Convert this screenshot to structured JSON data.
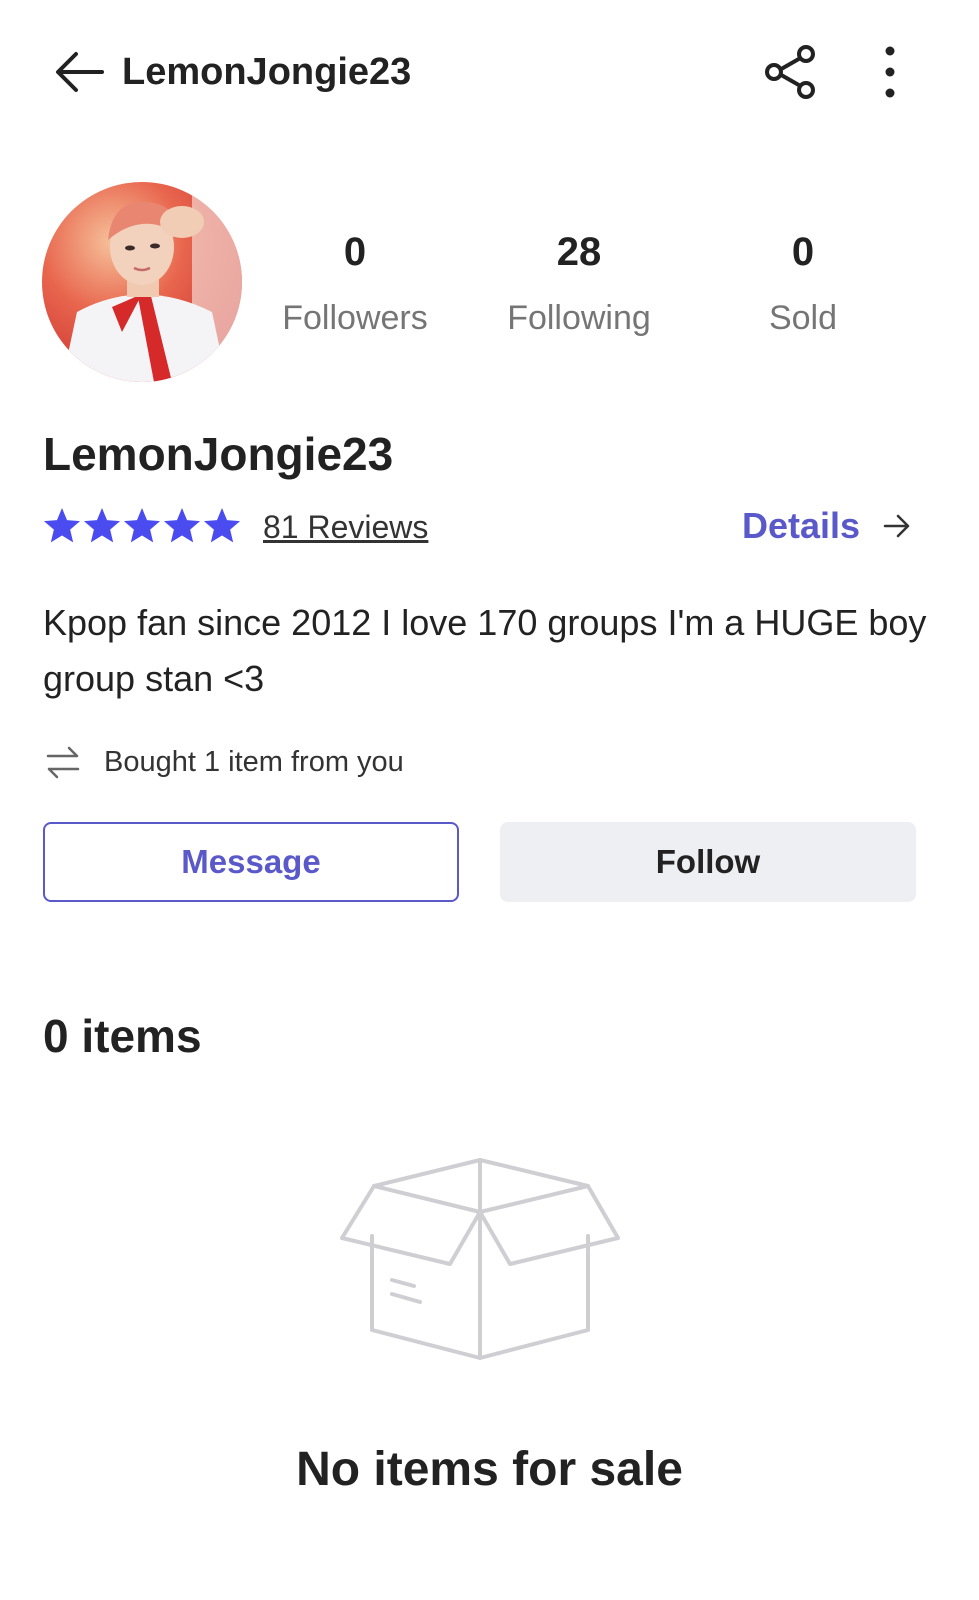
{
  "header": {
    "title": "LemonJongie23",
    "back_icon": "arrow-left-icon",
    "share_icon": "share-icon",
    "more_icon": "more-vertical-icon"
  },
  "profile": {
    "avatar": "avatar",
    "stats": [
      {
        "value": "0",
        "label": "Followers"
      },
      {
        "value": "28",
        "label": "Following"
      },
      {
        "value": "0",
        "label": "Sold"
      }
    ],
    "name": "LemonJongie23",
    "rating": {
      "stars": 5,
      "max": 5,
      "reviews_label": "81 Reviews"
    },
    "details_label": "Details",
    "bio": "Kpop fan since 2012 I love 170 groups I'm a HUGE boy group stan <3",
    "transaction": {
      "icon": "swap-arrows-icon",
      "text": "Bought 1 item from you"
    }
  },
  "actions": {
    "message_label": "Message",
    "follow_label": "Follow"
  },
  "items": {
    "count_label": "0 items",
    "empty_icon": "empty-box-icon",
    "empty_text": "No items for sale"
  },
  "colors": {
    "accent": "#5a59c9",
    "star": "#4b4cf0",
    "muted": "#757575",
    "follow_bg": "#eeeff2"
  }
}
